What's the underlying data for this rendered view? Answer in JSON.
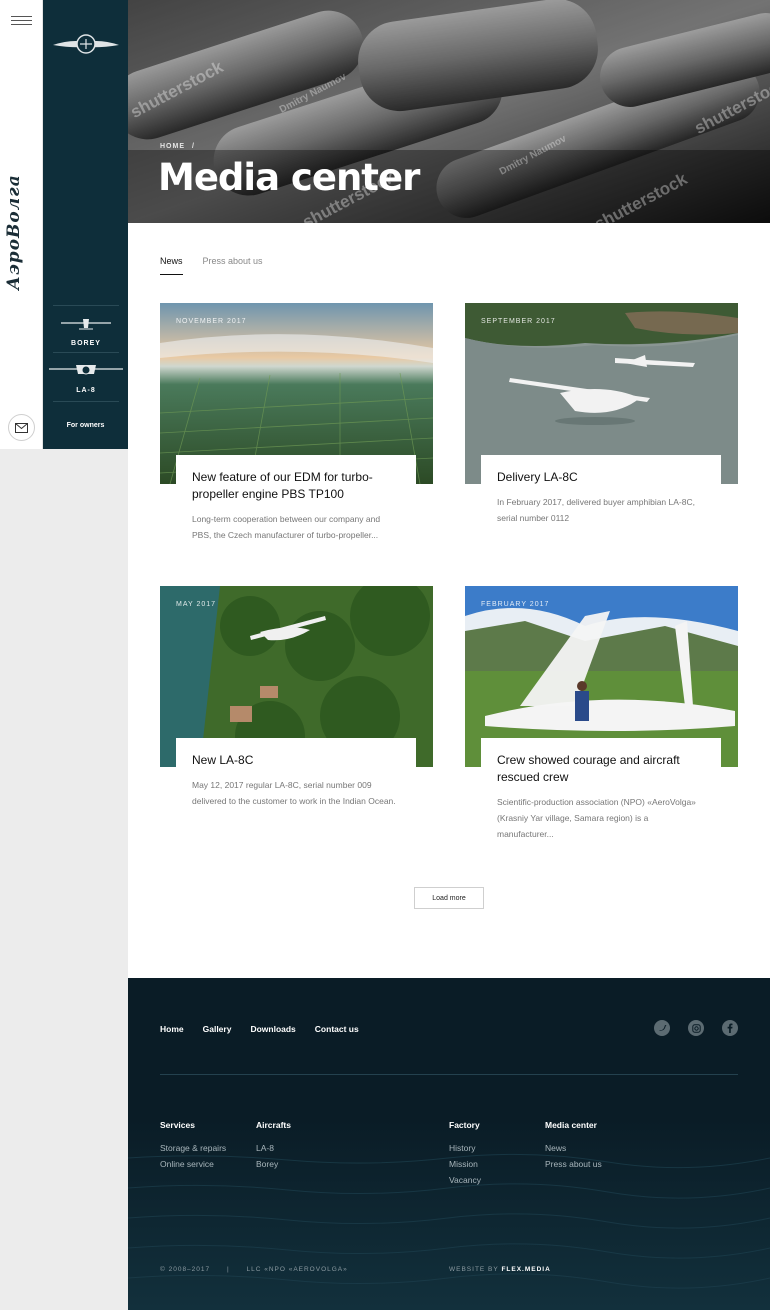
{
  "brand": {
    "name": "АэроВолга"
  },
  "sidebar": {
    "aircraft": [
      {
        "label": "BOREY"
      },
      {
        "label": "LA-8"
      }
    ],
    "for_owners": "For owners"
  },
  "hero": {
    "breadcrumb_home": "HOME",
    "breadcrumb_sep": "/",
    "title": "Media center",
    "watermarks": [
      "shutterstock",
      "Dmitry Naumov",
      "shutterstock",
      "shutterstock",
      "Dmitry Naumov",
      "shutterstock"
    ]
  },
  "tabs": [
    {
      "label": "News",
      "active": true
    },
    {
      "label": "Press about us",
      "active": false
    }
  ],
  "news": [
    {
      "date": "NOVEMBER 2017",
      "title": "New feature of our EDM for turbo-propeller engine PBS TP100",
      "excerpt": "Long-term cooperation between our company and PBS, the Czech manufacturer of turbo-propeller..."
    },
    {
      "date": "SEPTEMBER 2017",
      "title": "Delivery LA-8C",
      "excerpt": "In February 2017, delivered buyer amphibian LA-8C, serial number 0112"
    },
    {
      "date": "MAY 2017",
      "title": "New LA-8C",
      "excerpt": "May 12, 2017 regular LA-8C, serial number 009 delivered to the customer to work in the Indian Ocean."
    },
    {
      "date": "FEBRUARY 2017",
      "title": "Crew showed courage and aircraft rescued crew",
      "excerpt": "Scientific-production association (NPO) «AeroVolga» (Krasniy Yar village, Samara region) is a manufacturer..."
    }
  ],
  "load_more": "Load more",
  "footer": {
    "nav": [
      "Home",
      "Gallery",
      "Downloads",
      "Contact us"
    ],
    "social": [
      "twitter-icon",
      "instagram-icon",
      "facebook-icon"
    ],
    "columns": [
      {
        "heading": "Services",
        "links": [
          "Storage & repairs",
          "Online service"
        ]
      },
      {
        "heading": "Aircrafts",
        "links": [
          "LA-8",
          "Borey"
        ]
      },
      {
        "heading": "Factory",
        "links": [
          "History",
          "Mission",
          "Vacancy"
        ]
      },
      {
        "heading": "Media center",
        "links": [
          "News",
          "Press about us"
        ]
      }
    ],
    "copyright": "© 2008–2017",
    "separator": "|",
    "company": "LLC «NPO «AEROVOLGA»",
    "credit_prefix": "WEBSITE BY",
    "credit_brand": "FLEX.MEDIA"
  }
}
